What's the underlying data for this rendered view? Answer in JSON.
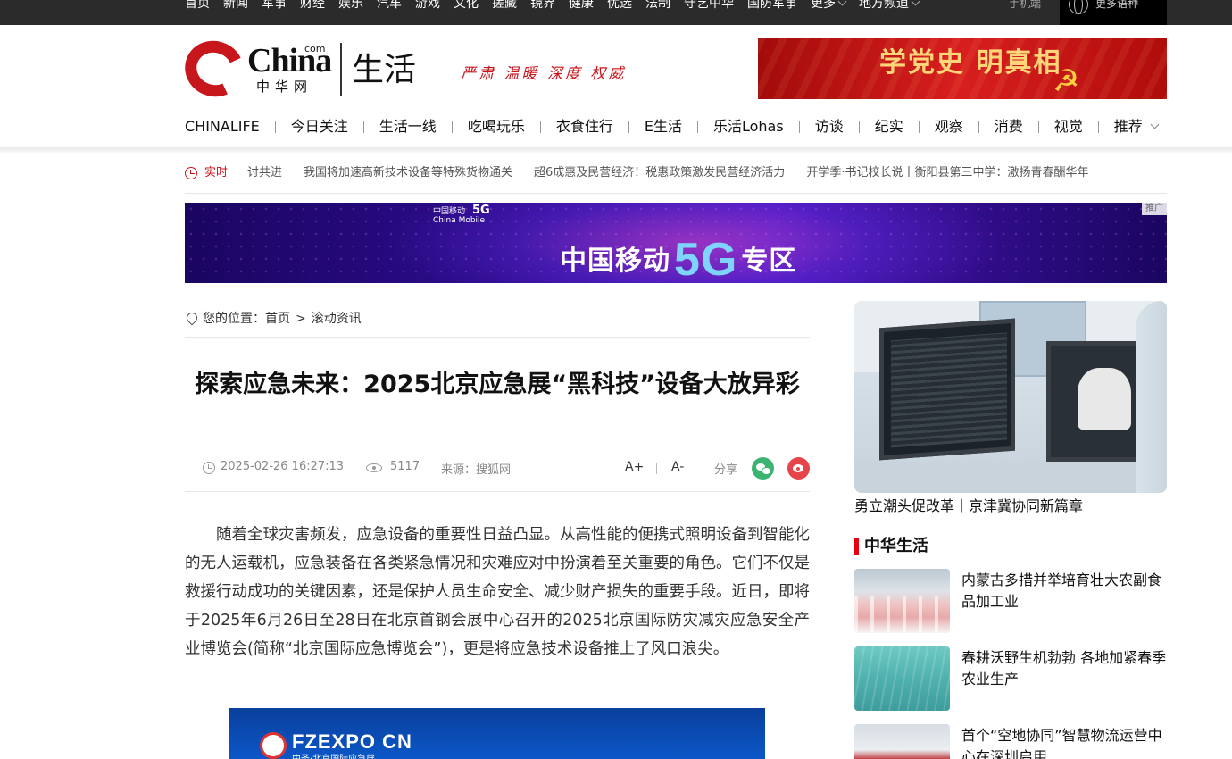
{
  "topbar": {
    "nav": [
      "首页",
      "新闻",
      "军事",
      "财经",
      "娱乐",
      "汽车",
      "游戏",
      "文化",
      "搓藏",
      "镜界",
      "健康",
      "优选",
      "法制",
      "守艺中华",
      "国防军事",
      "更多",
      "地方频道"
    ],
    "mobile": "手机端",
    "language": "更多语种",
    "icons": [
      "chevron-down-icon",
      "globe-icon"
    ]
  },
  "header": {
    "logo_text": "China",
    "logo_com": "com",
    "logo_cn": "中华网",
    "channel": "生活",
    "slogan": "严肃 温暖 深度 权威",
    "banner_text": "学党史 明真相",
    "banner_emblem": "☭"
  },
  "mainnav": [
    "CHINALIFE",
    "今日关注",
    "生活一线",
    "吃喝玩乐",
    "衣食住行",
    "E生活",
    "乐活Lohas",
    "访谈",
    "纪实",
    "观察",
    "消费",
    "视觉",
    "推荐"
  ],
  "ticker": {
    "label": "实时",
    "items": [
      "讨共进",
      "我国将加速高新技术设备等特殊货物通关",
      "超6成惠及民营经济！税惠政策激发民营经济活力",
      "开学季·书记校长说丨衡阳县第三中学：激扬青春酬华年"
    ]
  },
  "ad_5g": {
    "brand": "中国移动",
    "brand_en": "China Mobile",
    "tag": "5G",
    "prefix": "中国移动",
    "big": "5G",
    "suffix": "专区",
    "ad_label": "推广"
  },
  "article": {
    "breadcrumb_label": "您的位置：",
    "breadcrumb_home": "首页",
    "breadcrumb_sep": ">",
    "breadcrumb_current": "滚动资讯",
    "title": "探索应急未来：2025北京应急展“黑科技”设备大放异彩",
    "time": "2025-02-26 16:27:13",
    "views": "5117",
    "source": "来源：搜狐网",
    "font_plus": "A+",
    "font_minus": "A-",
    "share": "分享",
    "paragraph": "随着全球灾害频发，应急设备的重要性日益凸显。从高性能的便携式照明设备到智能化的无人运载机，应急装备在各类紧急情况和灾难应对中扮演着至关重要的角色。它们不仅是救援行动成功的关键因素，还是保护人员生命安全、减少财产损失的重要手段。近日，即将于2025年6月26日至28日在北京首钢会展中心召开的2025北京国际防灾减灾应急安全产业博览会(简称“北京国际应急博览会”)，更是将应急技术设备推上了风口浪尖。",
    "image_title": "FZEXPO CN",
    "image_sub": "中圣·北京国际应急展"
  },
  "sidebar": {
    "feature_caption": "勇立潮头促改革丨京津冀协同新篇章",
    "section_title": "中华生活",
    "news": [
      {
        "title": "内蒙古多措并举培育壮大农副食品加工业",
        "thumb": "food"
      },
      {
        "title": "春耕沃野生机勃勃 各地加紧春季农业生产",
        "thumb": "sea"
      },
      {
        "title": "首个“空地协同”智慧物流运营中心在深圳启用",
        "thumb": "bldg"
      }
    ]
  },
  "colors": {
    "brand_red": "#c8161d",
    "topbar_bg": "#2b2b2b",
    "section_red": "#e60012",
    "wechat_green": "#3cb371",
    "weibo_red": "#e6444a"
  }
}
